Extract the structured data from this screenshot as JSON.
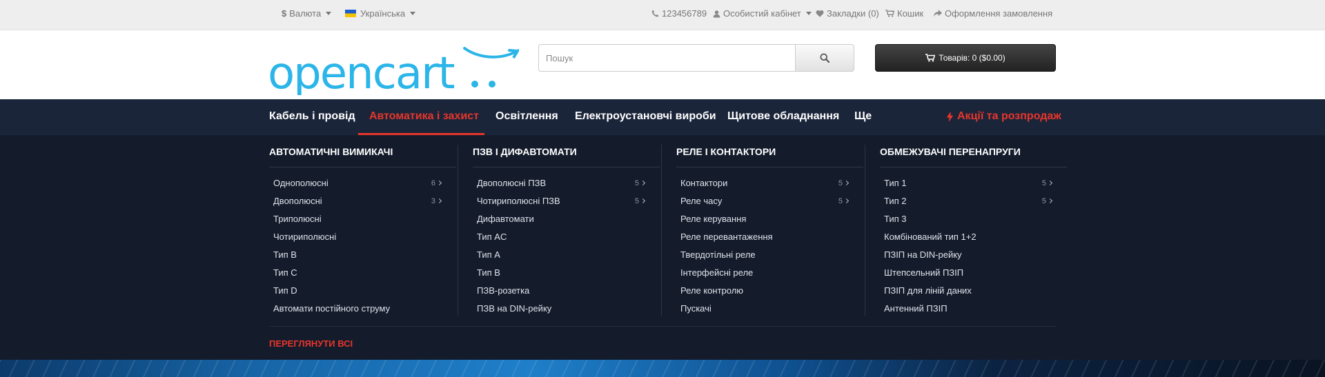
{
  "topbar": {
    "currency_label": "Валюта",
    "language_label": "Українська",
    "phone": "123456789",
    "account_label": "Особистий кабінет",
    "wishlist_label": "Закладки (0)",
    "cart_label": "Кошик",
    "checkout_label": "Оформлення замовлення"
  },
  "header": {
    "logo_text": "opencart",
    "search_placeholder": "Пошук",
    "cart_button_label": "Товарів: 0 ($0.00)"
  },
  "nav": {
    "items": [
      "Кабель і провід",
      "Автоматика і захист",
      "Освітлення",
      "Електроустановчі вироби",
      "Щитове обладнання",
      "Ще"
    ],
    "active_index": 1,
    "promo_label": "Акції та розпродаж"
  },
  "mega_menu": {
    "columns": [
      {
        "title": "АВТОМАТИЧНІ ВИМИКАЧІ",
        "items": [
          {
            "label": "Однополюсні",
            "count": "6"
          },
          {
            "label": "Двополюсні",
            "count": "3"
          },
          {
            "label": "Триполюсні",
            "count": ""
          },
          {
            "label": "Чотириполюсні",
            "count": ""
          },
          {
            "label": "Тип B",
            "count": ""
          },
          {
            "label": "Тип C",
            "count": ""
          },
          {
            "label": "Тип D",
            "count": ""
          },
          {
            "label": "Автомати постійного струму",
            "count": ""
          }
        ]
      },
      {
        "title": "ПЗВ І ДИФАВТОМАТИ",
        "items": [
          {
            "label": "Двополюсні ПЗВ",
            "count": "5"
          },
          {
            "label": "Чотириполюсні ПЗВ",
            "count": "5"
          },
          {
            "label": "Дифавтомати",
            "count": ""
          },
          {
            "label": "Тип AC",
            "count": ""
          },
          {
            "label": "Тип A",
            "count": ""
          },
          {
            "label": "Тип B",
            "count": ""
          },
          {
            "label": "ПЗВ-розетка",
            "count": ""
          },
          {
            "label": "ПЗВ на DIN-рейку",
            "count": ""
          }
        ]
      },
      {
        "title": "РЕЛЕ І КОНТАКТОРИ",
        "items": [
          {
            "label": "Контактори",
            "count": "5"
          },
          {
            "label": "Реле часу",
            "count": "5"
          },
          {
            "label": "Реле керування",
            "count": ""
          },
          {
            "label": "Реле перевантаження",
            "count": ""
          },
          {
            "label": "Твердотільні реле",
            "count": ""
          },
          {
            "label": "Інтерфейсні реле",
            "count": ""
          },
          {
            "label": "Реле контролю",
            "count": ""
          },
          {
            "label": "Пускачі",
            "count": ""
          }
        ]
      },
      {
        "title": "ОБМЕЖУВАЧІ ПЕРЕНАПРУГИ",
        "items": [
          {
            "label": "Тип 1",
            "count": "5"
          },
          {
            "label": "Тип 2",
            "count": "5"
          },
          {
            "label": "Тип 3",
            "count": ""
          },
          {
            "label": "Комбінований тип 1+2",
            "count": ""
          },
          {
            "label": "ПЗІП на DIN-рейку",
            "count": ""
          },
          {
            "label": "Штепсельний ПЗІП",
            "count": ""
          },
          {
            "label": "ПЗІП для ліній даних",
            "count": ""
          },
          {
            "label": "Антенний ПЗІП",
            "count": ""
          }
        ]
      }
    ],
    "view_all_label": "ПЕРЕГЛЯНУТИ ВСІ"
  },
  "colors": {
    "accent": "#e8352a",
    "nav_bg": "#1b253a",
    "mega_bg": "#141c2c",
    "logo_blue": "#2bb5e8"
  }
}
